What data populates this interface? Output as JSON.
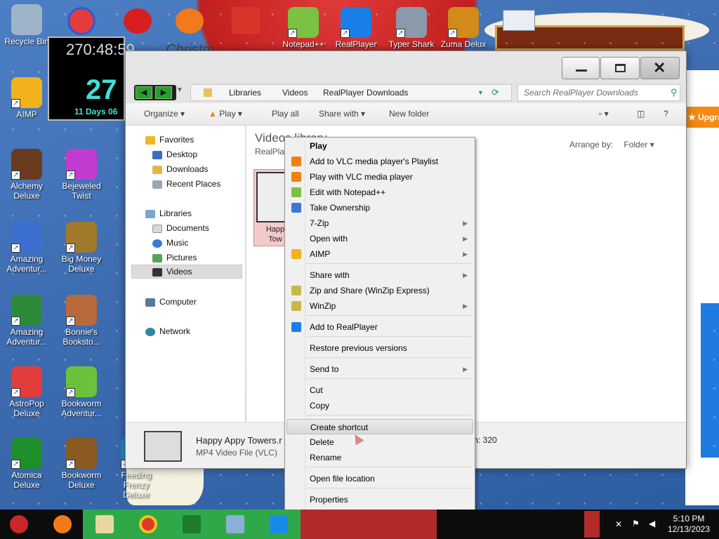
{
  "desktop": {
    "icons": [
      {
        "label": "Recycle Bin",
        "color": "#9fb4c8"
      },
      {
        "label": "AIMP",
        "color": "#f2b21c"
      },
      {
        "label": "Alchemy Deluxe",
        "color": "#6a3b1f"
      },
      {
        "label": "Amazing Adventur...",
        "color": "#3d6fd0"
      },
      {
        "label": "Amazing Adventur...",
        "color": "#2d8a3a"
      },
      {
        "label": "AstroPop Deluxe",
        "color": "#e23c3c"
      },
      {
        "label": "Atomica Deluxe",
        "color": "#1f8f2b"
      },
      {
        "label": "Deluxe",
        "color": "#2a6cc4"
      },
      {
        "label": "Bejeweled Twist",
        "color": "#c23bd1"
      },
      {
        "label": "Big Money Deluxe",
        "color": "#a07a2a"
      },
      {
        "label": "Bonnie's Booksto...",
        "color": "#b86a3a"
      },
      {
        "label": "Bookworm Adventur...",
        "color": "#6cc13a"
      },
      {
        "label": "Bookworm Deluxe",
        "color": "#8b5a23"
      },
      {
        "label": "Feeding Frenzy Deluxe",
        "color": "#2a8ac4"
      }
    ],
    "top_icons": [
      {
        "label": "Notepad++",
        "color": "#7bc142"
      },
      {
        "label": "RealPlayer",
        "color": "#1a7ee8"
      },
      {
        "label": "Typer Shark",
        "color": "#8a9aaa"
      },
      {
        "label": "Zuma Delux",
        "color": "#d28a1a"
      }
    ],
    "clock": {
      "countdown": "270:48:59",
      "title_partial": "Christm",
      "big_number": "27",
      "days_text": "11 Days 06"
    },
    "upgrade_label": "★ Upgra"
  },
  "explorer": {
    "breadcrumb": [
      "Libraries",
      "Videos",
      "RealPlayer Downloads"
    ],
    "search_placeholder": "Search RealPlayer Downloads",
    "toolbar": {
      "organize": "Organize",
      "play": "Play",
      "play_all": "Play all",
      "share_with": "Share with",
      "new_folder": "New folder"
    },
    "nav": {
      "favorites": "Favorites",
      "desktop": "Desktop",
      "downloads": "Downloads",
      "recent_places": "Recent Places",
      "libraries": "Libraries",
      "documents": "Documents",
      "music": "Music",
      "pictures": "Pictures",
      "videos": "Videos",
      "computer": "Computer",
      "network": "Network"
    },
    "library_title": "Videos library",
    "library_subtitle": "RealPlay",
    "arrange_by": "Arrange by:",
    "arrange_value": "Folder",
    "file_thumb_label_1": "Happ",
    "file_thumb_label_2": "Tow",
    "details": {
      "name": "Happy Appy  Towers.r",
      "type": "MP4 Video File (VLC)",
      "width_label": "th: 320"
    }
  },
  "context_menu": {
    "items": [
      {
        "label": "Play",
        "bold": true,
        "submenu": false,
        "icon": ""
      },
      {
        "label": "Add to VLC media player's Playlist",
        "submenu": false,
        "icon": "vlc-icon"
      },
      {
        "label": "Play with VLC media player",
        "submenu": false,
        "icon": "vlc-icon"
      },
      {
        "label": "Edit with Notepad++",
        "submenu": false,
        "icon": "notepad-icon"
      },
      {
        "label": "Take Ownership",
        "submenu": false,
        "icon": "shield-icon"
      },
      {
        "label": "7-Zip",
        "submenu": true,
        "icon": ""
      },
      {
        "label": "Open with",
        "submenu": true,
        "icon": ""
      },
      {
        "label": "AIMP",
        "submenu": true,
        "icon": "aimp-icon"
      },
      {
        "label": "Share with",
        "submenu": true,
        "icon": ""
      },
      {
        "label": "Zip and Share (WinZip Express)",
        "submenu": false,
        "icon": "winzip-icon"
      },
      {
        "label": "WinZip",
        "submenu": true,
        "icon": "winzip-icon"
      },
      {
        "label": "Add to RealPlayer",
        "submenu": false,
        "icon": "realplayer-icon"
      },
      {
        "label": "Restore previous versions",
        "submenu": false,
        "icon": ""
      },
      {
        "label": "Send to",
        "submenu": true,
        "icon": ""
      },
      {
        "label": "Cut",
        "submenu": false,
        "icon": ""
      },
      {
        "label": "Copy",
        "submenu": false,
        "icon": ""
      },
      {
        "label": "Create shortcut",
        "submenu": false,
        "icon": "",
        "highlighted": true
      },
      {
        "label": "Delete",
        "submenu": false,
        "icon": ""
      },
      {
        "label": "Rename",
        "submenu": false,
        "icon": ""
      },
      {
        "label": "Open file location",
        "submenu": false,
        "icon": ""
      },
      {
        "label": "Properties",
        "submenu": false,
        "icon": ""
      }
    ]
  },
  "taskbar": {
    "time": "5:10 PM",
    "date": "12/13/2023"
  }
}
